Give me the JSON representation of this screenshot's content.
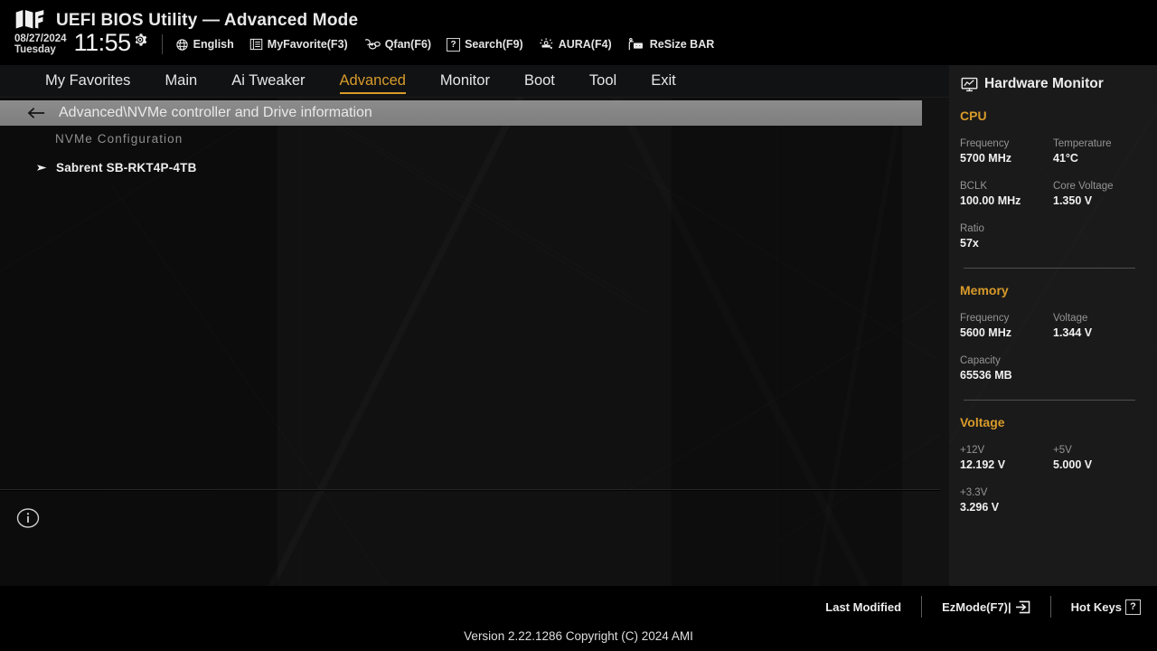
{
  "header": {
    "logo_icon": "tuf-shield-logo",
    "title": "UEFI BIOS Utility — Advanced Mode",
    "date": "08/27/2024",
    "weekday": "Tuesday",
    "time": "11:55",
    "gear_icon": "gear-icon",
    "hotbar": [
      {
        "icon": "globe-icon",
        "label": "English"
      },
      {
        "icon": "list-icon",
        "label": "MyFavorite(F3)"
      },
      {
        "icon": "fan-icon",
        "label": "Qfan(F6)"
      },
      {
        "icon": "question-icon",
        "label": "Search(F9)"
      },
      {
        "icon": "aura-light-icon",
        "label": "AURA(F4)"
      },
      {
        "icon": "resize-bar-icon",
        "label": "ReSize BAR"
      }
    ]
  },
  "nav": {
    "active": "Advanced",
    "tabs": [
      {
        "label": "My Favorites"
      },
      {
        "label": "Main"
      },
      {
        "label": "Ai Tweaker"
      },
      {
        "label": "Advanced"
      },
      {
        "label": "Monitor"
      },
      {
        "label": "Boot"
      },
      {
        "label": "Tool"
      },
      {
        "label": "Exit"
      }
    ]
  },
  "content": {
    "back_icon": "back-arrow-icon",
    "breadcrumb": "Advanced\\NVMe controller and Drive information",
    "section_label": "NVMe Configuration",
    "drive_arrow_icon": "right-triangle-icon",
    "drive_name": "Sabrent SB-RKT4P-4TB",
    "info_icon": "info-circle-icon"
  },
  "hardware_monitor": {
    "panel_icon": "monitor-icon",
    "title": "Hardware Monitor",
    "groups": [
      {
        "name": "CPU",
        "items": [
          {
            "label": "Frequency",
            "value": "5700 MHz",
            "full": false
          },
          {
            "label": "Temperature",
            "value": "41°C",
            "full": false
          },
          {
            "label": "BCLK",
            "value": "100.00 MHz",
            "full": false
          },
          {
            "label": "Core Voltage",
            "value": "1.350 V",
            "full": false
          },
          {
            "label": "Ratio",
            "value": "57x",
            "full": true
          }
        ]
      },
      {
        "name": "Memory",
        "items": [
          {
            "label": "Frequency",
            "value": "5600 MHz",
            "full": false
          },
          {
            "label": "Voltage",
            "value": "1.344 V",
            "full": false
          },
          {
            "label": "Capacity",
            "value": "65536 MB",
            "full": true
          }
        ]
      },
      {
        "name": "Voltage",
        "items": [
          {
            "label": "+12V",
            "value": "12.192 V",
            "full": false
          },
          {
            "label": "+5V",
            "value": "5.000 V",
            "full": false
          },
          {
            "label": "+3.3V",
            "value": "3.296 V",
            "full": true
          }
        ]
      }
    ]
  },
  "footer": {
    "last_modified": "Last Modified",
    "ezmode": "EzMode(F7)|",
    "ezmode_icon": "enter-arrow-icon",
    "hotkeys": "Hot Keys",
    "hotkeys_icon": "question-key-icon",
    "hotkeys_key": "?",
    "version": "Version 2.22.1286 Copyright (C) 2024 AMI"
  },
  "colors": {
    "accent": "#d89b2a",
    "panel_bg": "#1a1a1a",
    "breadcrumb_bg": "#8c8c8c",
    "text": "#e8e8e8",
    "muted": "#949494"
  }
}
